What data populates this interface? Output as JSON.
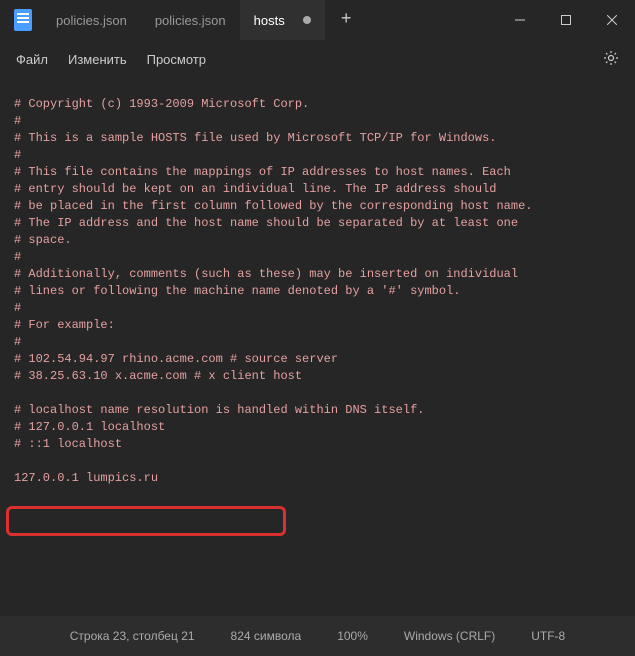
{
  "tabs": [
    {
      "label": "policies.json"
    },
    {
      "label": "policies.json"
    },
    {
      "label": "hosts"
    }
  ],
  "menu": {
    "file": "Файл",
    "edit": "Изменить",
    "view": "Просмотр"
  },
  "content": {
    "l1": "# Copyright (c) 1993-2009 Microsoft Corp.",
    "l2": "#",
    "l3": "# This is a sample HOSTS file used by Microsoft TCP/IP for Windows.",
    "l4": "#",
    "l5": "# This file contains the mappings of IP addresses to host names. Each",
    "l6": "# entry should be kept on an individual line. The IP address should",
    "l7": "# be placed in the first column followed by the corresponding host name.",
    "l8": "# The IP address and the host name should be separated by at least one",
    "l9": "# space.",
    "l10": "#",
    "l11": "# Additionally, comments (such as these) may be inserted on individual",
    "l12": "# lines or following the machine name denoted by a '#' symbol.",
    "l13": "#",
    "l14": "# For example:",
    "l15": "#",
    "l16": "#      102.54.94.97     rhino.acme.com          # source server",
    "l17": "#       38.25.63.10     x.acme.com              # x client host",
    "l18_blank": "",
    "l19": "# localhost name resolution is handled within DNS itself.",
    "l20": "#       127.0.0.1       localhost",
    "l21": "#       ::1             localhost",
    "l22_blank": "",
    "l23": "127.0.0.1 lumpics.ru"
  },
  "status": {
    "pos": "Строка 23, столбец 21",
    "chars": "824 символа",
    "zoom": "100%",
    "eol": "Windows (CRLF)",
    "enc": "UTF-8"
  }
}
